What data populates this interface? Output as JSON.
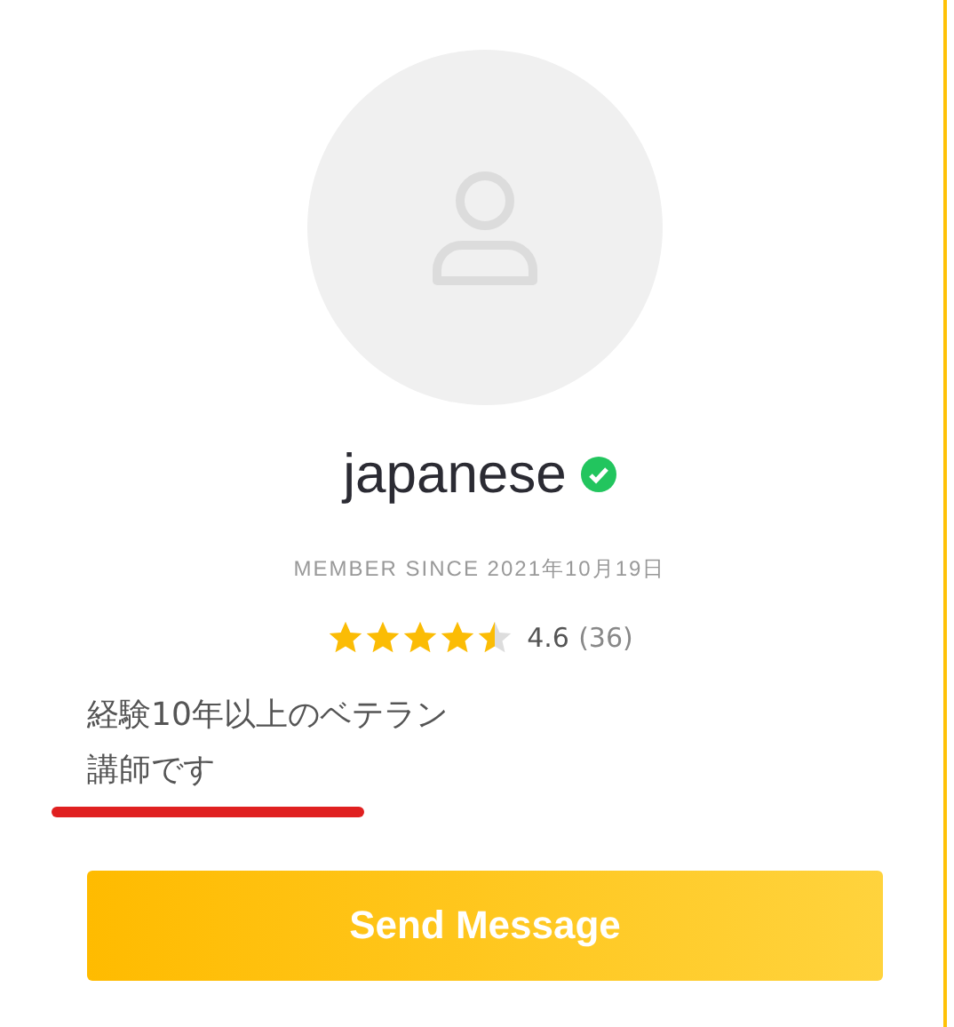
{
  "profile": {
    "name": "japanese",
    "verified": true,
    "member_since": "MEMBER SINCE 2021年10月19日",
    "stars": 4.5,
    "rating": "4.6",
    "review_count": "(36)",
    "bio": "経験10年以上のベテラン講師です"
  },
  "buttons": [
    "Send Message"
  ]
}
